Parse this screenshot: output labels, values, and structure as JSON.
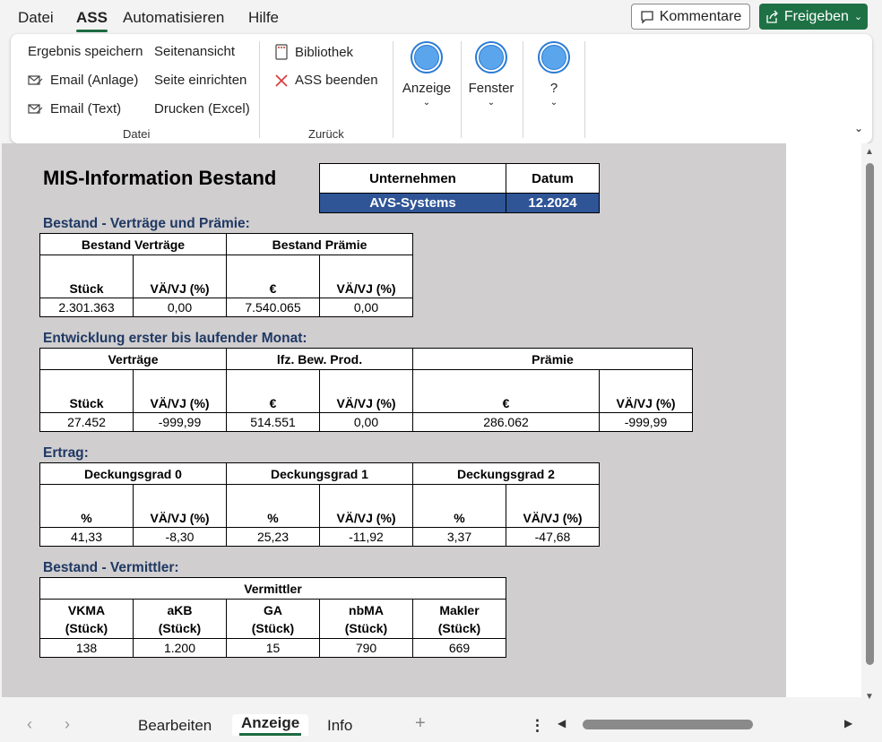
{
  "menu": {
    "items": [
      "Datei",
      "ASS",
      "Automatisieren",
      "Hilfe"
    ],
    "comment_label": "Kommentare",
    "share_label": "Freigeben"
  },
  "ribbon": {
    "datei": {
      "ergebnis_speichern": "Ergebnis speichern",
      "email_anlage": "Email (Anlage)",
      "email_text": "Email (Text)",
      "seitenansicht": "Seitenansicht",
      "seite_einrichten": "Seite einrichten",
      "drucken": "Drucken (Excel)",
      "group_label": "Datei"
    },
    "zurueck": {
      "bibliothek": "Bibliothek",
      "ass_beenden": "ASS beenden",
      "group_label": "Zurück"
    },
    "anzeige": "Anzeige",
    "fenster": "Fenster",
    "help": "?"
  },
  "sheet": {
    "title": "MIS-Information Bestand",
    "company_header": "Unternehmen",
    "date_header": "Datum",
    "company": "AVS-Systems",
    "date": "12.2024",
    "sec1": {
      "title": "Bestand - Verträge und Prämie:",
      "h_vertraege": "Bestand Verträge",
      "h_praemie": "Bestand Prämie",
      "c1": "Stück",
      "c2": "VÄ/VJ (%)",
      "c3": "€",
      "c4": "VÄ/VJ (%)",
      "v1": "2.301.363",
      "v2": "0,00",
      "v3": "7.540.065",
      "v4": "0,00"
    },
    "sec2": {
      "title": "Entwicklung erster bis laufender Monat:",
      "h_vertraege": "Verträge",
      "h_lfz": "lfz. Bew. Prod.",
      "h_praemie": "Prämie",
      "c1": "Stück",
      "c2": "VÄ/VJ (%)",
      "c3": "€",
      "c4": "VÄ/VJ (%)",
      "c5": "€",
      "c6": "VÄ/VJ (%)",
      "v1": "27.452",
      "v2": "-999,99",
      "v3": "514.551",
      "v4": "0,00",
      "v5": "286.062",
      "v6": "-999,99"
    },
    "sec3": {
      "title": "Ertrag:",
      "h_dg0": "Deckungsgrad 0",
      "h_dg1": "Deckungsgrad 1",
      "h_dg2": "Deckungsgrad 2",
      "c1": "%",
      "c2": "VÄ/VJ (%)",
      "c3": "%",
      "c4": "VÄ/VJ (%)",
      "c5": "%",
      "c6": "VÄ/VJ (%)",
      "v1": "41,33",
      "v2": "-8,30",
      "v3": "25,23",
      "v4": "-11,92",
      "v5": "3,37",
      "v6": "-47,68"
    },
    "sec4": {
      "title": "Bestand - Vermittler:",
      "h_vermittler": "Vermittler",
      "cols": [
        {
          "name": "VKMA",
          "unit": "(Stück)",
          "value": "138"
        },
        {
          "name": "aKB",
          "unit": "(Stück)",
          "value": "1.200"
        },
        {
          "name": "GA",
          "unit": "(Stück)",
          "value": "15"
        },
        {
          "name": "nbMA",
          "unit": "(Stück)",
          "value": "790"
        },
        {
          "name": "Makler",
          "unit": "(Stück)",
          "value": "669"
        }
      ]
    }
  },
  "tabs": {
    "bearbeiten": "Bearbeiten",
    "anzeige": "Anzeige",
    "info": "Info",
    "add": "+",
    "more": "⋮"
  }
}
